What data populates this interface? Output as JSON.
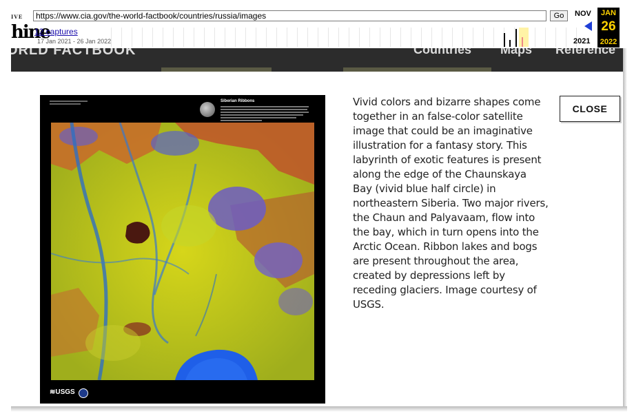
{
  "wayback": {
    "logo_top": "IVE",
    "logo_main": "hine",
    "url": "https://www.cia.gov/the-world-factbook/countries/russia/images",
    "go_label": "Go",
    "captures_label": "12 captures",
    "capture_range": "17 Jan 2021 - 26 Jan 2022",
    "prev_month": "NOV",
    "prev_year": "2021",
    "current_month": "JAN",
    "current_day": "26",
    "current_year": "2022",
    "accent_color": "#ffd200",
    "arrow_color": "#1f3fd6",
    "icons": [
      "prev-capture-arrow-icon"
    ]
  },
  "site": {
    "title": "ORLD FACTBOOK",
    "nav": {
      "countries": "Countries",
      "maps": "Maps",
      "reference": "Reference"
    }
  },
  "modal": {
    "close_label": "CLOSE",
    "poster_title": "Siberian Ribbons",
    "caption": "Vivid colors and bizarre shapes come together in an false-color satellite image that could be an imaginative illustration for a fantasy story. This labyrinth of exotic features is present along the edge of the Chaunskaya Bay (vivid blue half circle) in northeastern Siberia. Two major rivers, the Chaun and Palyavaam, flow into the bay, which in turn opens into the Arctic Ocean. Ribbon lakes and bogs are present throughout the area, created by depressions left by receding glaciers. Image courtesy of USGS.",
    "usgs_logo": "≋USGS"
  }
}
